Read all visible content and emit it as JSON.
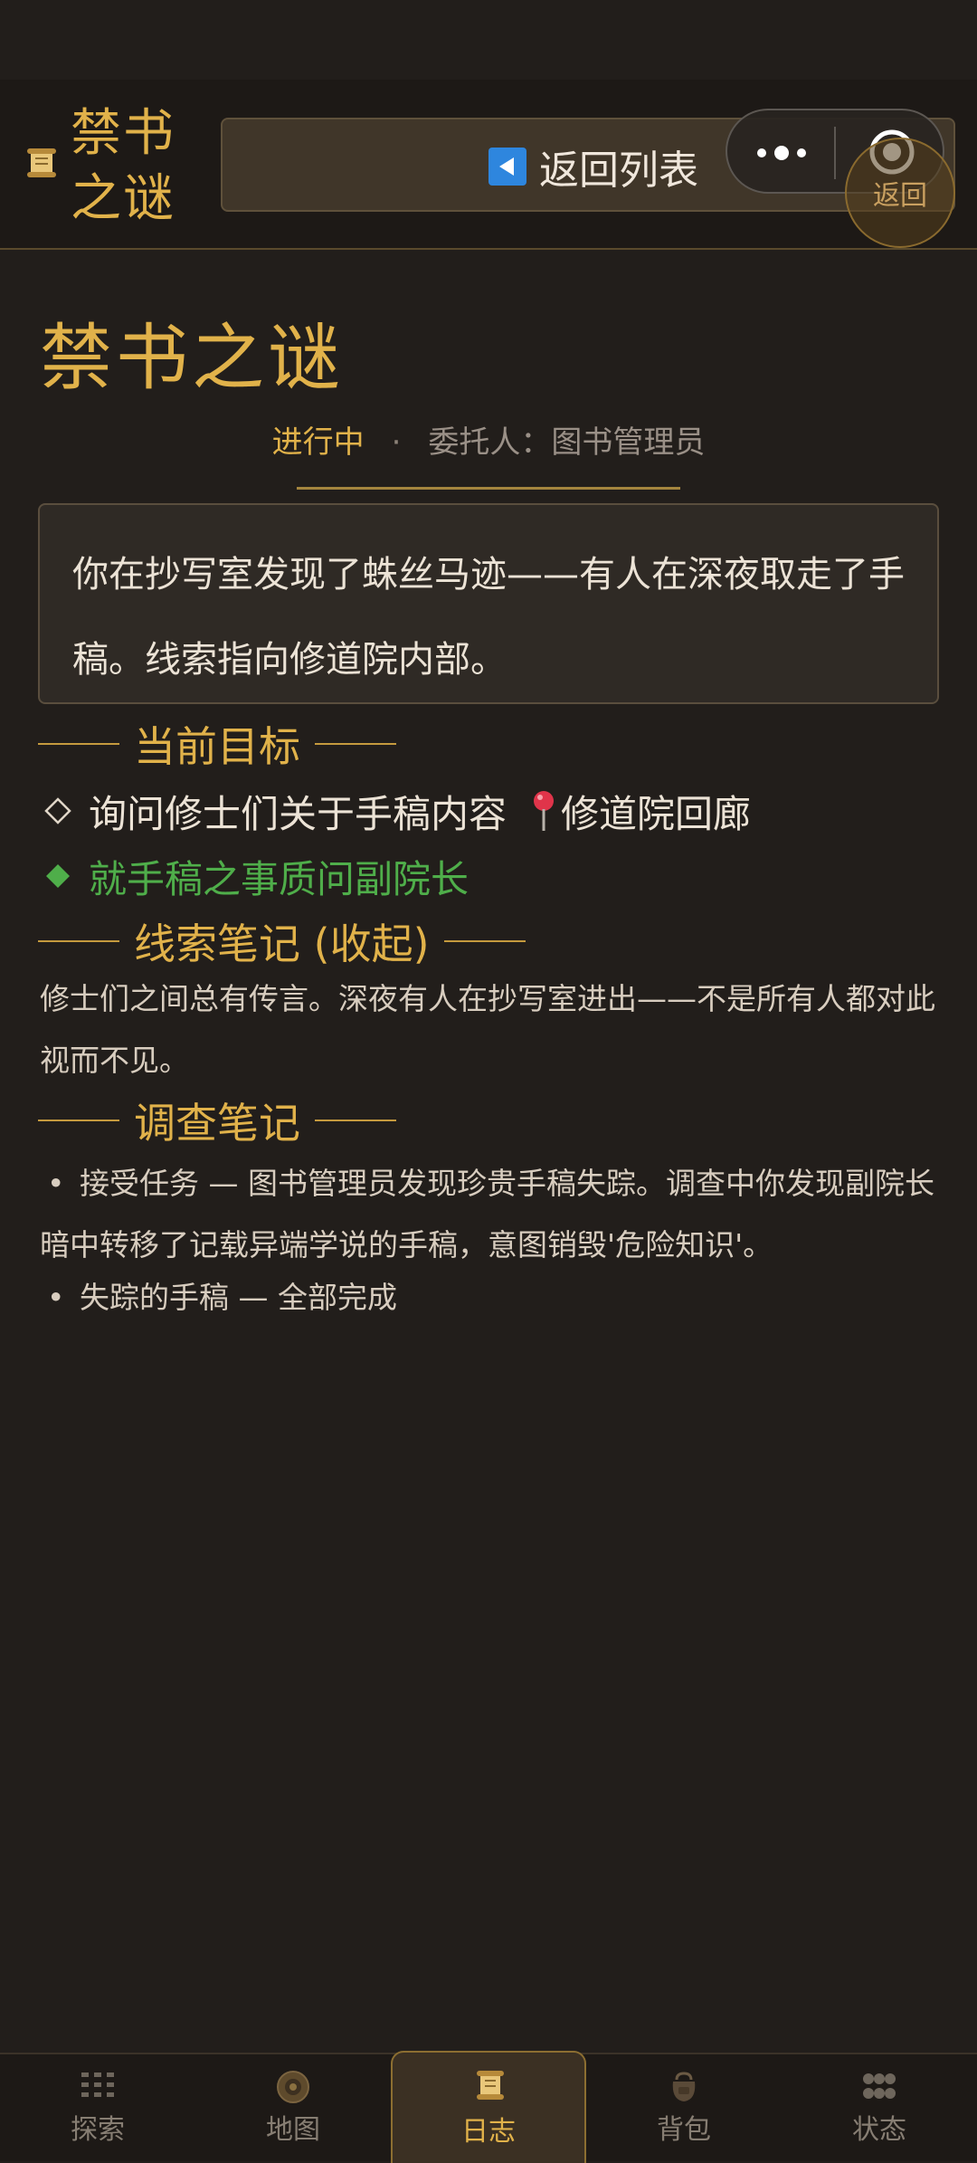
{
  "header": {
    "logo_title": "禁书之谜",
    "back_label": "返回列表",
    "float_back_label": "返回"
  },
  "quest": {
    "title": "禁书之谜",
    "status": "进行中",
    "separator": "·",
    "client": "委托人：图书管理员",
    "description": "你在抄写室发现了蛛丝马迹——有人在深夜取走了手稿。线索指向修道院内部。"
  },
  "objectives": {
    "heading": "当前目标",
    "items": [
      {
        "marker": "◇",
        "text": "询问修士们关于手稿内容",
        "location": "修道院回廊"
      },
      {
        "marker": "◆",
        "text": "就手稿之事质问副院长"
      }
    ]
  },
  "clues": {
    "heading": "线索笔记 (收起)",
    "text": "修士们之间总有传言。深夜有人在抄写室进出——不是所有人都对此视而不见。"
  },
  "investigation": {
    "heading": "调查笔记",
    "items": [
      {
        "marker": "•",
        "text": "接受任务 — 图书管理员发现珍贵手稿失踪。调查中你发现副院长暗中转移了记载异端学说的手稿，意图销毁'危险知识'。"
      },
      {
        "marker": "•",
        "text": "失踪的手稿 — 全部完成"
      }
    ]
  },
  "tabs": [
    {
      "label": "探索",
      "icon": "grid-icon"
    },
    {
      "label": "地图",
      "icon": "compass-icon"
    },
    {
      "label": "日志",
      "icon": "scroll-icon",
      "active": true
    },
    {
      "label": "背包",
      "icon": "bag-icon"
    },
    {
      "label": "状态",
      "icon": "dots-icon"
    }
  ],
  "colors": {
    "accent_gold": "#e1b24a",
    "active_green": "#4fae4a",
    "background": "#221e1b"
  }
}
